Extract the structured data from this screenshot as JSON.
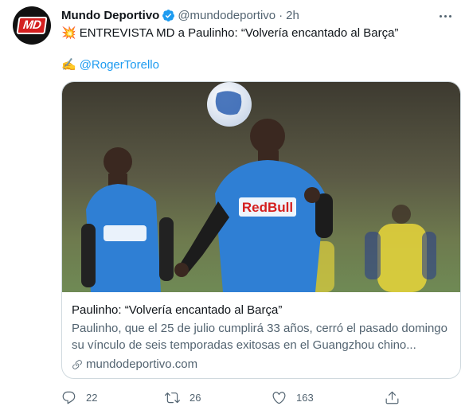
{
  "tweet": {
    "author_name": "Mundo Deportivo",
    "author_handle": "@mundodeportivo",
    "separator": "·",
    "time": "2h",
    "avatar_text": "MD",
    "text_emoji": "💥",
    "text": "ENTREVISTA MD a Paulinho: “Volvería encantado al Barça”",
    "byline_emoji": "✍️",
    "byline_link": "@RogerTorello"
  },
  "card": {
    "title": "Paulinho: “Volvería encantado al Barça”",
    "description": "Paulinho, que el 25 de julio cumplirá 33 años, cerró el pasado domingo su vínculo de seis temporadas exitosas en el Guangzhou chino...",
    "domain": "mundodeportivo.com",
    "image_jersey_text": "RedBull"
  },
  "actions": {
    "replies": "22",
    "retweets": "26",
    "likes": "163"
  },
  "colors": {
    "accent": "#1d9bf0",
    "text_secondary": "#536471",
    "border": "#cfd9de",
    "jersey_blue": "#2f7fd4",
    "brand_red": "#d41f1f"
  },
  "icons": [
    "verified-badge-icon",
    "more-icon",
    "link-icon",
    "reply-icon",
    "retweet-icon",
    "like-icon",
    "share-icon"
  ]
}
